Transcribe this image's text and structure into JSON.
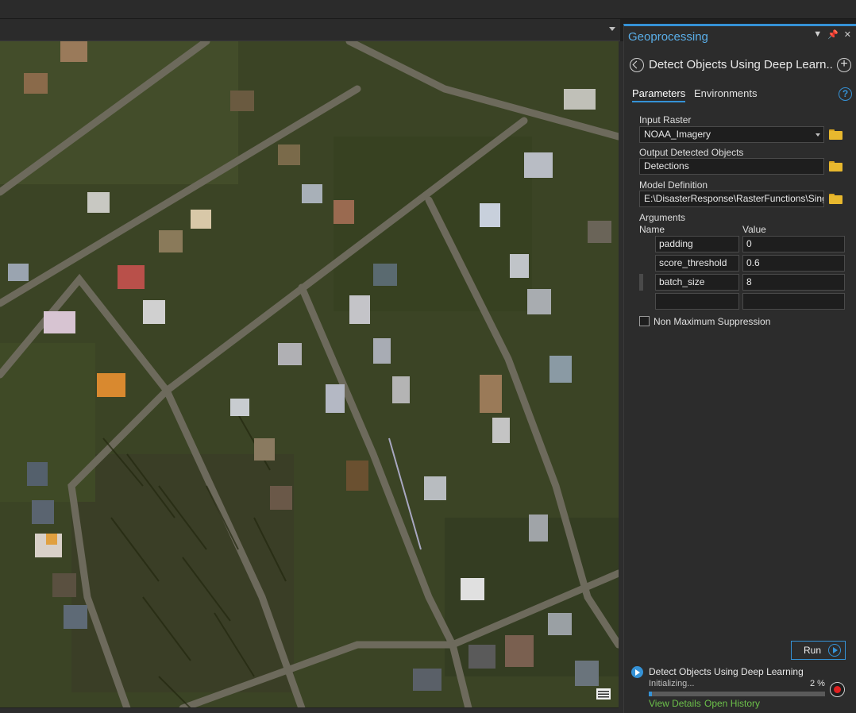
{
  "map": {
    "imagery": "aerial-imagery-residential-storm-damage",
    "tool_icon": "table-icon"
  },
  "panel": {
    "title": "Geoprocessing",
    "controls": [
      "dropdown-icon",
      "pin-icon",
      "close-icon"
    ],
    "tool_title": "Detect Objects Using Deep Learn...",
    "tabs": [
      {
        "label": "Parameters",
        "active": true
      },
      {
        "label": "Environments",
        "active": false
      }
    ],
    "help": "?"
  },
  "params": {
    "input_raster_label": "Input Raster",
    "input_raster_value": "NOAA_Imagery",
    "output_label": "Output Detected Objects",
    "output_value": "Detections",
    "model_label": "Model Definition",
    "model_value": "E:\\DisasterResponse\\RasterFunctions\\SingleClassHouseDetection.emd",
    "arguments_label": "Arguments",
    "name_col": "Name",
    "value_col": "Value",
    "arguments": [
      {
        "name": "padding",
        "value": "0"
      },
      {
        "name": "score_threshold",
        "value": "0.6"
      },
      {
        "name": "batch_size",
        "value": "8"
      },
      {
        "name": "",
        "value": ""
      }
    ],
    "nms_label": "Non Maximum Suppression",
    "nms_checked": false
  },
  "run": {
    "label": "Run"
  },
  "progress": {
    "tool_name": "Detect Objects Using Deep Learning",
    "status": "Initializing...",
    "percent_label": "2 %",
    "percent": 0.02,
    "view_details": "View Details",
    "open_history": "Open History"
  },
  "colors": {
    "accent": "#3592d6",
    "link": "#6cc04a",
    "folder": "#e8b82e",
    "stop": "#e02020"
  }
}
